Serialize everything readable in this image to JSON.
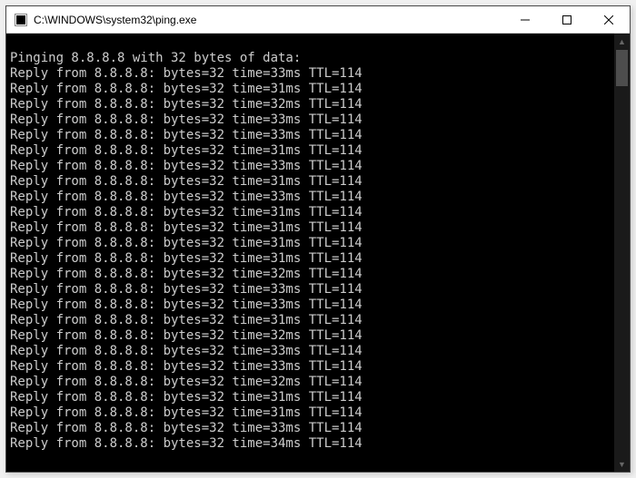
{
  "window": {
    "title": "C:\\WINDOWS\\system32\\ping.exe"
  },
  "console": {
    "header": "Pinging 8.8.8.8 with 32 bytes of data:",
    "replies": [
      {
        "from": "8.8.8.8",
        "bytes": 32,
        "time_ms": 33,
        "ttl": 114
      },
      {
        "from": "8.8.8.8",
        "bytes": 32,
        "time_ms": 31,
        "ttl": 114
      },
      {
        "from": "8.8.8.8",
        "bytes": 32,
        "time_ms": 32,
        "ttl": 114
      },
      {
        "from": "8.8.8.8",
        "bytes": 32,
        "time_ms": 33,
        "ttl": 114
      },
      {
        "from": "8.8.8.8",
        "bytes": 32,
        "time_ms": 33,
        "ttl": 114
      },
      {
        "from": "8.8.8.8",
        "bytes": 32,
        "time_ms": 31,
        "ttl": 114
      },
      {
        "from": "8.8.8.8",
        "bytes": 32,
        "time_ms": 33,
        "ttl": 114
      },
      {
        "from": "8.8.8.8",
        "bytes": 32,
        "time_ms": 31,
        "ttl": 114
      },
      {
        "from": "8.8.8.8",
        "bytes": 32,
        "time_ms": 33,
        "ttl": 114
      },
      {
        "from": "8.8.8.8",
        "bytes": 32,
        "time_ms": 31,
        "ttl": 114
      },
      {
        "from": "8.8.8.8",
        "bytes": 32,
        "time_ms": 31,
        "ttl": 114
      },
      {
        "from": "8.8.8.8",
        "bytes": 32,
        "time_ms": 31,
        "ttl": 114
      },
      {
        "from": "8.8.8.8",
        "bytes": 32,
        "time_ms": 31,
        "ttl": 114
      },
      {
        "from": "8.8.8.8",
        "bytes": 32,
        "time_ms": 32,
        "ttl": 114
      },
      {
        "from": "8.8.8.8",
        "bytes": 32,
        "time_ms": 33,
        "ttl": 114
      },
      {
        "from": "8.8.8.8",
        "bytes": 32,
        "time_ms": 33,
        "ttl": 114
      },
      {
        "from": "8.8.8.8",
        "bytes": 32,
        "time_ms": 31,
        "ttl": 114
      },
      {
        "from": "8.8.8.8",
        "bytes": 32,
        "time_ms": 32,
        "ttl": 114
      },
      {
        "from": "8.8.8.8",
        "bytes": 32,
        "time_ms": 33,
        "ttl": 114
      },
      {
        "from": "8.8.8.8",
        "bytes": 32,
        "time_ms": 33,
        "ttl": 114
      },
      {
        "from": "8.8.8.8",
        "bytes": 32,
        "time_ms": 32,
        "ttl": 114
      },
      {
        "from": "8.8.8.8",
        "bytes": 32,
        "time_ms": 31,
        "ttl": 114
      },
      {
        "from": "8.8.8.8",
        "bytes": 32,
        "time_ms": 31,
        "ttl": 114
      },
      {
        "from": "8.8.8.8",
        "bytes": 32,
        "time_ms": 33,
        "ttl": 114
      },
      {
        "from": "8.8.8.8",
        "bytes": 32,
        "time_ms": 34,
        "ttl": 114
      }
    ]
  }
}
